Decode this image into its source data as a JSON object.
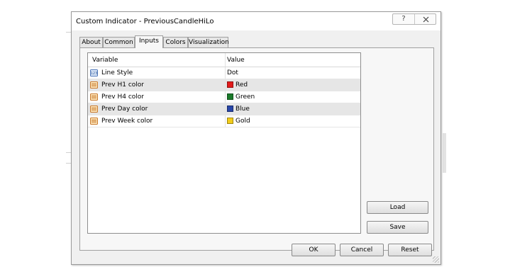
{
  "window": {
    "title": "Custom Indicator - PreviousCandleHiLo",
    "help_glyph": "?",
    "close_glyph": "X"
  },
  "tabs": [
    {
      "label": "About"
    },
    {
      "label": "Common"
    },
    {
      "label": "Inputs",
      "active": true
    },
    {
      "label": "Colors"
    },
    {
      "label": "Visualization"
    }
  ],
  "grid": {
    "columns": [
      "Variable",
      "Value"
    ],
    "rows": [
      {
        "name": "Line Style",
        "value": "Dot",
        "icon": "number-param-icon"
      },
      {
        "name": "Prev H1 color",
        "value": "Red",
        "color": "#e21b1b",
        "icon": "color-param-icon"
      },
      {
        "name": "Prev H4 color",
        "value": "Green",
        "color": "#1a7a2a",
        "icon": "color-param-icon"
      },
      {
        "name": "Prev Day color",
        "value": "Blue",
        "color": "#2846a8",
        "icon": "color-param-icon"
      },
      {
        "name": "Prev Week color",
        "value": "Gold",
        "color": "#f2cc1a",
        "icon": "color-param-icon"
      }
    ]
  },
  "buttons": {
    "load": "Load",
    "save": "Save",
    "ok": "OK",
    "cancel": "Cancel",
    "reset": "Reset"
  }
}
